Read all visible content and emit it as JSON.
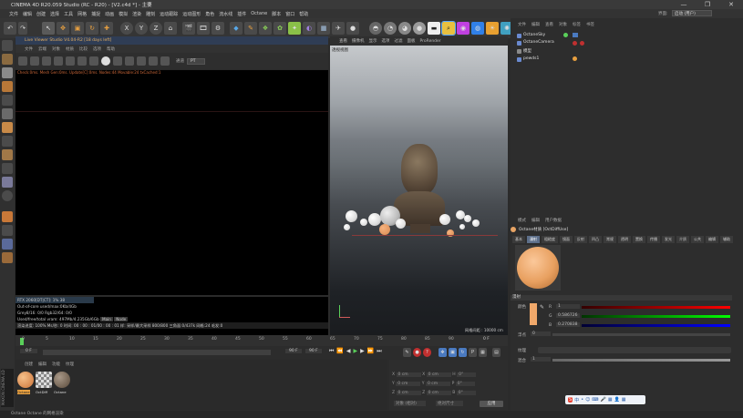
{
  "window": {
    "title": "CINEMA 4D R20.059 Studio (RC - R20) - [V2.c4d *] - 主要",
    "controls": [
      "—",
      "❐",
      "✕"
    ]
  },
  "menubar": {
    "items": [
      "文件",
      "编辑",
      "创建",
      "选择",
      "工具",
      "网格",
      "捕捉",
      "动画",
      "模拟",
      "渲染",
      "雕刻",
      "运动跟踪",
      "运动图形",
      "角色",
      "流水线",
      "插件",
      "Octane",
      "脚本",
      "窗口",
      "帮助"
    ],
    "layout_label": "界面:",
    "layout_value": "启动 (用户)"
  },
  "live_viewer": {
    "title": "Live Viewer Studio V4.04-R2 [18 days left]",
    "menu": [
      "文件",
      "云端",
      "对象",
      "材质",
      "比较",
      "选项",
      "帮助"
    ],
    "channel_label": "通道",
    "channel_value": "PT",
    "status": "Check:0ms. Mesh Gen:0ms. Update[C]:0ms. Nodes:44 Movable:24 txCached:1",
    "stats": [
      "RTX 2060[DT|CT]: 1%  38",
      "Out-of-core used/max:0Kb/4Gb",
      "Grey8/16: 0/0    Rgb32/64: 0/0",
      "Used/free/total vram: 497Mb/4.235Gb/6Gb",
      "渲染进度: 100%   Ms/秒: 0   时间: 00 : 00 : 01/00 : 00 : 01   样: 采样/最大采样 800/800   三角面:0/437k   网格:24  毛发:0"
    ],
    "resume_label": "Main",
    "resume_value": "Node"
  },
  "viewport": {
    "menu": [
      "查看",
      "摄像机",
      "显示",
      "选项",
      "过滤",
      "面板",
      "ProRender"
    ],
    "label": "透视视图",
    "distance": "网格间距 : 10000 cm"
  },
  "timeline": {
    "ticks": [
      "0",
      "5",
      "10",
      "15",
      "20",
      "25",
      "30",
      "35",
      "40",
      "45",
      "50",
      "55",
      "60",
      "65",
      "70",
      "75",
      "80",
      "85",
      "90"
    ],
    "current_frame": "0 F",
    "start_frame": "0 F",
    "end_frame": "90 F",
    "end_frame2": "90 F"
  },
  "material_manager": {
    "menu": [
      "创建",
      "编辑",
      "功能",
      "纹理"
    ],
    "materials": [
      {
        "name": "Octane",
        "color": "#e8a464"
      },
      {
        "name": "OctDiff",
        "color": "#c9c9c9"
      },
      {
        "name": "Octane",
        "color": "#7a6a5a"
      }
    ]
  },
  "coordinates": {
    "rows": [
      {
        "axis": "X",
        "pos": "0 cm",
        "axis2": "X",
        "size": "0 cm",
        "rot_axis": "H",
        "rot": "0°"
      },
      {
        "axis": "Y",
        "pos": "0 cm",
        "axis2": "Y",
        "size": "0 cm",
        "rot_axis": "P",
        "rot": "0°"
      },
      {
        "axis": "Z",
        "pos": "0 cm",
        "axis2": "Z",
        "size": "0 cm",
        "rot_axis": "B",
        "rot": "0°"
      }
    ],
    "mode_left": "对象 (相对)",
    "mode_right": "绝对尺寸",
    "apply": "应用"
  },
  "object_manager": {
    "menu": [
      "文件",
      "编辑",
      "查看",
      "对象",
      "标签",
      "书签"
    ],
    "objects": [
      {
        "name": "OctaneSky",
        "color": "#6a8ad0"
      },
      {
        "name": "OctaneCamera",
        "color": "#6a8ad0"
      },
      {
        "name": "模型",
        "color": "#8a8a8a"
      },
      {
        "name": "pewds1",
        "color": "#6a8ad0"
      }
    ]
  },
  "attributes": {
    "menu": [
      "模式",
      "编辑",
      "用户数据"
    ],
    "material_title": "Octane材质 [OctDiffUse]",
    "tabs": [
      "基本",
      "漫射",
      "粗糙度",
      "镜面",
      "反射",
      "凹凸",
      "常规",
      "透明",
      "置换",
      "传播",
      "发光",
      "介质",
      "公共",
      "编辑",
      "辅助"
    ],
    "active_tab": "漫射",
    "section": "漫射",
    "color_label": "颜色",
    "r_label": "R",
    "r_value": "1",
    "g_label": "G",
    "g_value": "0.586726",
    "b_label": "B",
    "b_value": "0.270838",
    "float_label": "浮点",
    "float_value": "0",
    "texture_label": "纹理",
    "mix_label": "混合",
    "mix_value": "1",
    "color_swatch": "#f0a86a"
  },
  "statusbar": {
    "text": "Octane   Octane 的网格渲染"
  },
  "ime": {
    "items": [
      "S",
      "中",
      "•",
      "☺",
      "⌨",
      "🎤",
      "▦",
      "👤",
      "▦"
    ]
  }
}
